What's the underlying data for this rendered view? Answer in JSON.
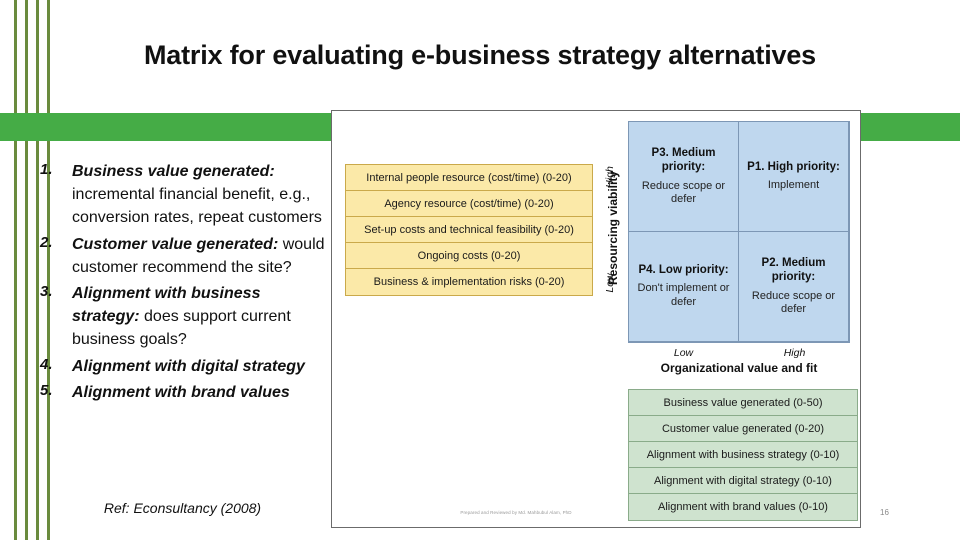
{
  "slide": {
    "title": "Matrix for evaluating e-business strategy alternatives",
    "page_number": "16",
    "accent_green": "#45ac46",
    "rule_green": "#6a8b3e"
  },
  "bullets": [
    {
      "num": "1.",
      "lead": "Business value generated:",
      "rest": " incremental financial benefit, e.g., conversion rates, repeat customers"
    },
    {
      "num": "2.",
      "lead": "Customer value generated:",
      "rest": " would customer recommend the site?"
    },
    {
      "num": "3.",
      "lead": "Alignment with business strategy:",
      "rest": " does support current business goals?"
    },
    {
      "num": "4.",
      "lead": "Alignment with digital strategy",
      "rest": ""
    },
    {
      "num": "5.",
      "lead": "Alignment with brand values",
      "rest": ""
    }
  ],
  "reference": "Ref: Econsultancy (2008)",
  "picture": {
    "credit": "Prepared and Reviewed by Md. Mahbubul Alam, PhD",
    "resourcing_criteria": [
      "Internal people resource (cost/time) (0-20)",
      "Agency resource (cost/time) (0-20)",
      "Set-up costs and technical feasibility (0-20)",
      "Ongoing costs (0-20)",
      "Business & implementation risks (0-20)"
    ],
    "value_criteria": [
      "Business value generated (0-50)",
      "Customer value generated (0-20)",
      "Alignment with business strategy (0-10)",
      "Alignment with digital strategy (0-10)",
      "Alignment with brand values (0-10)"
    ],
    "y_axis": {
      "label": "Resourcing viability",
      "high": "High",
      "low": "Low"
    },
    "x_axis": {
      "label": "Organizational value and fit",
      "low": "Low",
      "high": "High"
    },
    "quadrants": [
      {
        "heading": "P3. Medium priority:",
        "body": "Reduce scope or defer"
      },
      {
        "heading": "P1. High priority:",
        "body": "Implement"
      },
      {
        "heading": "P4. Low priority:",
        "body": "Don't implement or defer"
      },
      {
        "heading": "P2. Medium priority:",
        "body": "Reduce scope or defer"
      }
    ],
    "colors": {
      "criteria_yellow": "#fbe9a8",
      "quadrant_blue": "#bfd7ee",
      "scoring_green": "#cfe3cf"
    }
  }
}
